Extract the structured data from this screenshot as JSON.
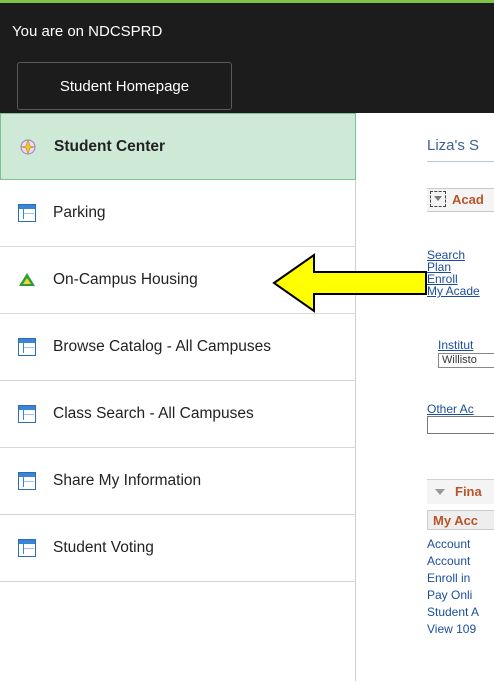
{
  "header": {
    "environment_text": "You are on NDCSPRD",
    "home_button": "Student Homepage"
  },
  "sidebar": {
    "items": [
      {
        "label": "Student Center",
        "icon": "student-center-icon",
        "active": true
      },
      {
        "label": "Parking",
        "icon": "page-icon"
      },
      {
        "label": "On-Campus Housing",
        "icon": "housing-icon"
      },
      {
        "label": "Browse Catalog - All Campuses",
        "icon": "page-icon"
      },
      {
        "label": "Class Search - All Campuses",
        "icon": "page-icon"
      },
      {
        "label": "Share My Information",
        "icon": "page-icon"
      },
      {
        "label": "Student Voting",
        "icon": "page-icon"
      }
    ]
  },
  "content": {
    "title": "Liza's S",
    "academics_header": "Acad",
    "academic_links": [
      "Search",
      "Plan",
      "Enroll",
      "My Acade"
    ],
    "institution_label": "Institut",
    "institution_value": "Willisto",
    "other_label": "Other Ac",
    "finances_header": "Fina",
    "my_account_header": "My Acc",
    "finance_links": [
      "Account",
      "Account",
      "Enroll in",
      "Pay Onli",
      "Student A",
      "View 109"
    ]
  },
  "colors": {
    "topbar": "#1c1c1c",
    "active_item_bg": "#cfe9d7",
    "link": "#1a4d9c",
    "section_header": "#b8542a",
    "arrow_fill": "#ffff00"
  }
}
